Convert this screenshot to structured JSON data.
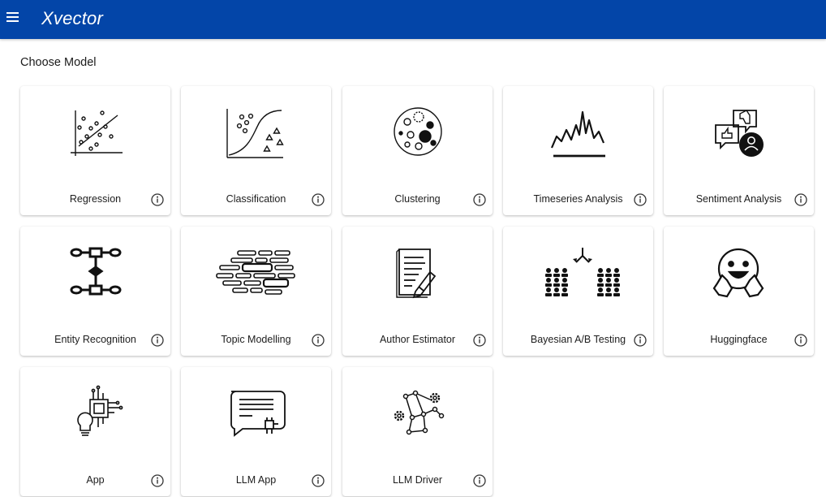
{
  "app": {
    "logo": "Xvector",
    "menu_icon": "hamburger-menu-icon"
  },
  "page": {
    "title": "Choose Model"
  },
  "cards": [
    {
      "label": "Regression",
      "icon": "scatter-plot-icon"
    },
    {
      "label": "Classification",
      "icon": "classification-plot-icon"
    },
    {
      "label": "Clustering",
      "icon": "clustering-icon"
    },
    {
      "label": "Timeseries Analysis",
      "icon": "timeseries-icon"
    },
    {
      "label": "Sentiment Analysis",
      "icon": "sentiment-icon"
    },
    {
      "label": "Entity Recognition",
      "icon": "entity-graph-icon"
    },
    {
      "label": "Topic Modelling",
      "icon": "topic-blocks-icon"
    },
    {
      "label": "Author Estimator",
      "icon": "document-pen-icon"
    },
    {
      "label": "Bayesian A/B Testing",
      "icon": "ab-testing-icon"
    },
    {
      "label": "Huggingface",
      "icon": "huggingface-icon"
    },
    {
      "label": "App",
      "icon": "chip-bulb-icon"
    },
    {
      "label": "LLM App",
      "icon": "chat-chip-icon"
    },
    {
      "label": "LLM Driver",
      "icon": "network-gears-icon"
    }
  ],
  "info_icon": "info-icon"
}
